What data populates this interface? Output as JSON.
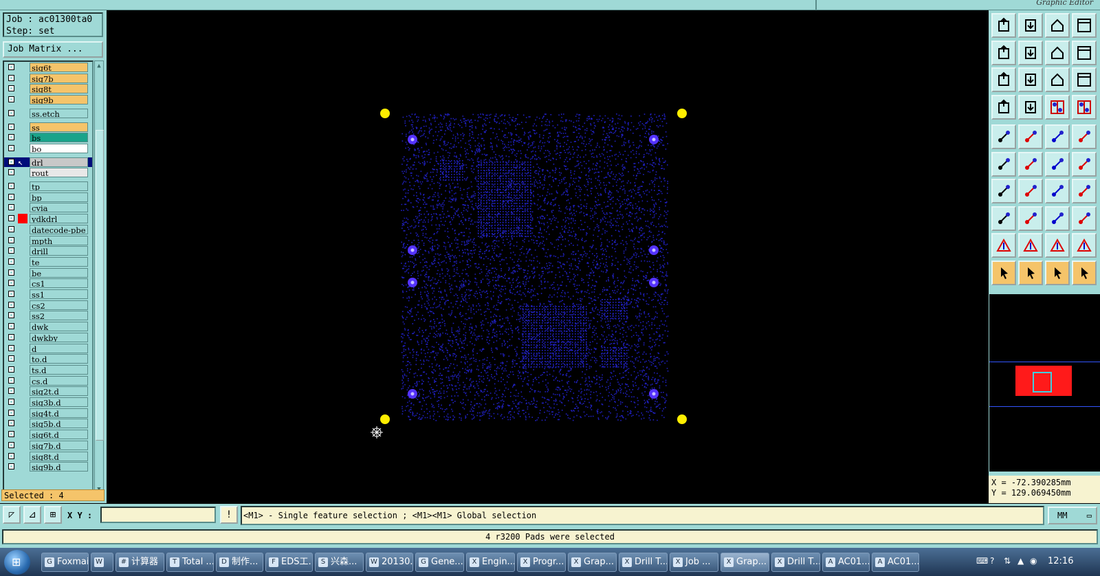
{
  "window": {
    "title_right": "Graphic Editor"
  },
  "job": {
    "job_label": "Job : ac01300ta0",
    "step_label": "Step: set",
    "matrix_button": "Job Matrix ..."
  },
  "layers": [
    {
      "name": "sig6t",
      "color": "#f5c46a"
    },
    {
      "name": "sig7b",
      "color": "#f5c46a"
    },
    {
      "name": "sig8t",
      "color": "#f5c46a"
    },
    {
      "name": "sig9b",
      "color": "#f5c46a"
    },
    {
      "name": "ss.etch",
      "color": "#9fd9d6"
    },
    {
      "name": "ss",
      "color": "#f5c46a"
    },
    {
      "name": "bs",
      "color": "#1aa38a"
    },
    {
      "name": "bo",
      "color": "#ffffff"
    },
    {
      "name": "drl",
      "color": "#c8c8c8",
      "active": true
    },
    {
      "name": "rout",
      "color": "#e8e8e8"
    },
    {
      "name": "tp",
      "color": "#9fd9d6"
    },
    {
      "name": "bp",
      "color": "#9fd9d6"
    },
    {
      "name": "cvia",
      "color": "#9fd9d6"
    },
    {
      "name": "ydkdrl",
      "color": "#9fd9d6",
      "flag": "#ff0000"
    },
    {
      "name": "datecode-pbe",
      "color": "#9fd9d6"
    },
    {
      "name": "mpth",
      "color": "#9fd9d6"
    },
    {
      "name": "drill",
      "color": "#9fd9d6"
    },
    {
      "name": "te",
      "color": "#9fd9d6"
    },
    {
      "name": "be",
      "color": "#9fd9d6"
    },
    {
      "name": "cs1",
      "color": "#9fd9d6"
    },
    {
      "name": "ss1",
      "color": "#9fd9d6"
    },
    {
      "name": "cs2",
      "color": "#9fd9d6"
    },
    {
      "name": "ss2",
      "color": "#9fd9d6"
    },
    {
      "name": "dwk",
      "color": "#9fd9d6"
    },
    {
      "name": "dwkby",
      "color": "#9fd9d6"
    },
    {
      "name": "d",
      "color": "#9fd9d6"
    },
    {
      "name": "to.d",
      "color": "#9fd9d6"
    },
    {
      "name": "ts.d",
      "color": "#9fd9d6"
    },
    {
      "name": "cs.d",
      "color": "#9fd9d6"
    },
    {
      "name": "sig2t.d",
      "color": "#9fd9d6"
    },
    {
      "name": "sig3b.d",
      "color": "#9fd9d6"
    },
    {
      "name": "sig4t.d",
      "color": "#9fd9d6"
    },
    {
      "name": "sig5b.d",
      "color": "#9fd9d6"
    },
    {
      "name": "sig6t.d",
      "color": "#9fd9d6"
    },
    {
      "name": "sig7b.d",
      "color": "#9fd9d6"
    },
    {
      "name": "sig8t.d",
      "color": "#9fd9d6"
    },
    {
      "name": "sig9b.d",
      "color": "#9fd9d6"
    }
  ],
  "selected_label": "Selected : 4",
  "colors": {
    "panel": "#9fd9d6",
    "highlight": "#f5c46a",
    "pad": "#ffee00",
    "drill": "#2020c0",
    "tooling": "#5533ff"
  },
  "toolbar_icons": [
    "open-step-icon",
    "save-icon",
    "home-icon",
    "window-icon",
    "prev-step-icon",
    "next-step-icon",
    "undo-icon",
    "redo-icon",
    "zoom-fit-icon",
    "zoom-in-icon",
    "scale-icon",
    "help-icon",
    "settings-icon",
    "grid-icon",
    "layer-compare-icon",
    "layer-compare2-icon",
    "measure-point-icon",
    "snap-icon",
    "ruler-icon",
    "pad-icon",
    "node-icon",
    "cross-icon",
    "line-icon",
    "line2-icon",
    "angle-icon",
    "slash-icon",
    "rotate-icon",
    "flip-icon",
    "add-pad-icon",
    "minus-icon",
    "dimension-icon",
    "shape-icon",
    "triangle-icon",
    "arrow-up-icon",
    "arrow-up2-icon",
    "arrow-up3-icon",
    "select-icon",
    "select2-icon",
    "select3-icon",
    "select4-icon"
  ],
  "coords": {
    "x": "X = -72.390285mm",
    "y": "Y = 129.069450mm"
  },
  "command": {
    "xy_label": "X Y :",
    "xy_value": "",
    "prompt": "<M1> - Single feature selection ; <M1><M1> Global selection",
    "units": "MM"
  },
  "status_message": "4 r3200 Pads were selected",
  "taskbar": {
    "items": [
      {
        "label": "Foxmail",
        "icon": "G"
      },
      {
        "label": "",
        "icon": "W"
      },
      {
        "label": "计算器",
        "icon": "#"
      },
      {
        "label": "Total ...",
        "icon": "T"
      },
      {
        "label": "制作...",
        "icon": "D"
      },
      {
        "label": "EDS工...",
        "icon": "F"
      },
      {
        "label": "兴森...",
        "icon": "S"
      },
      {
        "label": "20130...",
        "icon": "W"
      },
      {
        "label": "Gene...",
        "icon": "G"
      },
      {
        "label": "Engin...",
        "icon": "X"
      },
      {
        "label": "Progr...",
        "icon": "X"
      },
      {
        "label": "Grap...",
        "icon": "X"
      },
      {
        "label": "Drill T...",
        "icon": "X"
      },
      {
        "label": "Job ...",
        "icon": "X"
      },
      {
        "label": "Grap...",
        "icon": "X",
        "active": true
      },
      {
        "label": "Drill T...",
        "icon": "X"
      },
      {
        "label": "AC01...",
        "icon": "A"
      },
      {
        "label": "AC01...",
        "icon": "A"
      }
    ],
    "time": "12:16"
  }
}
